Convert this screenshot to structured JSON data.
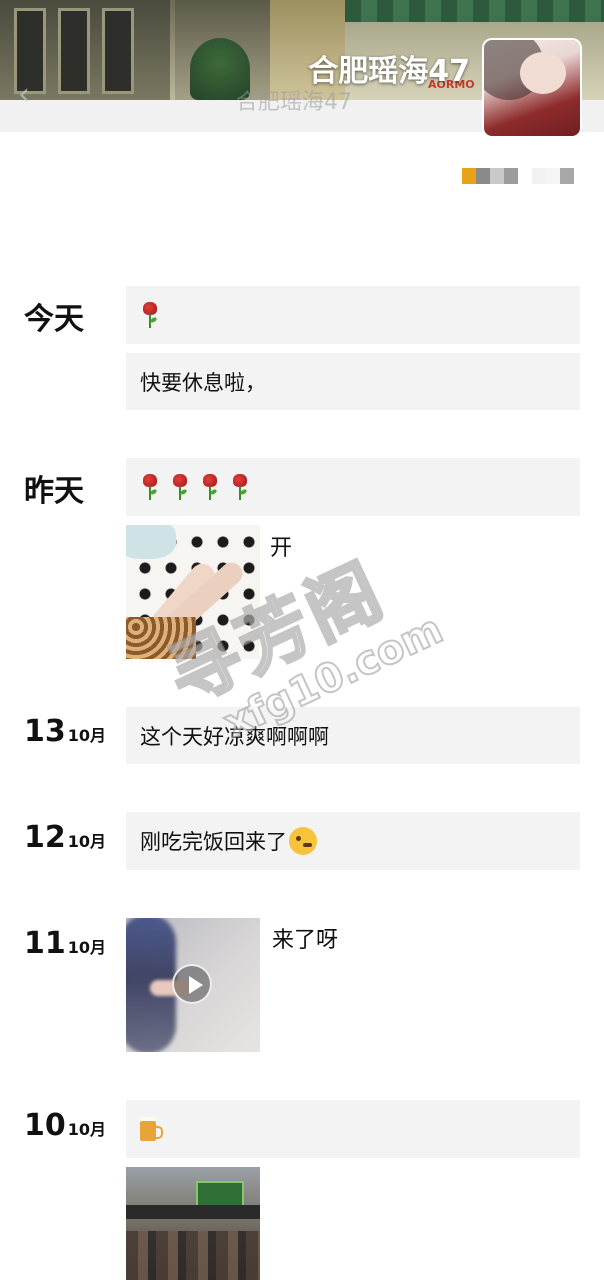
{
  "profile": {
    "name": "合肥瑶海47",
    "header_title": "合肥瑶海47",
    "cover_sign_text": "AORMO",
    "signature_colors": [
      "#e8a21a",
      "#8a8a8a",
      "#c9c9c9",
      "#9c9c9c",
      "#ffffff",
      "#f2f2f2",
      "#f5f5f5",
      "#a8a8a8"
    ]
  },
  "icons": {
    "back": "chevron-left-icon",
    "play": "play-icon"
  },
  "feed": [
    {
      "date": "今天",
      "posts": [
        {
          "type": "emoji",
          "emoji": "rose",
          "count": 1
        },
        {
          "type": "text",
          "text": "快要休息啦，"
        }
      ]
    },
    {
      "date": "昨天",
      "posts": [
        {
          "type": "emoji",
          "emoji": "rose",
          "count": 4
        },
        {
          "type": "image",
          "caption": "开"
        }
      ]
    },
    {
      "day": "13",
      "month": "10月",
      "posts": [
        {
          "type": "text",
          "text": "这个天好凉爽啊啊啊"
        }
      ]
    },
    {
      "day": "12",
      "month": "10月",
      "posts": [
        {
          "type": "text",
          "text": "刚吃完饭回来了",
          "emoji": "wink-face"
        }
      ]
    },
    {
      "day": "11",
      "month": "10月",
      "posts": [
        {
          "type": "video",
          "caption": "来了呀"
        }
      ]
    },
    {
      "day": "10",
      "month": "10月",
      "posts": [
        {
          "type": "emoji",
          "emoji": "beer",
          "count": 1
        },
        {
          "type": "image",
          "caption": ""
        }
      ]
    }
  ],
  "watermark": {
    "line1": "寻芳阁",
    "line2": "xfg10.com"
  }
}
